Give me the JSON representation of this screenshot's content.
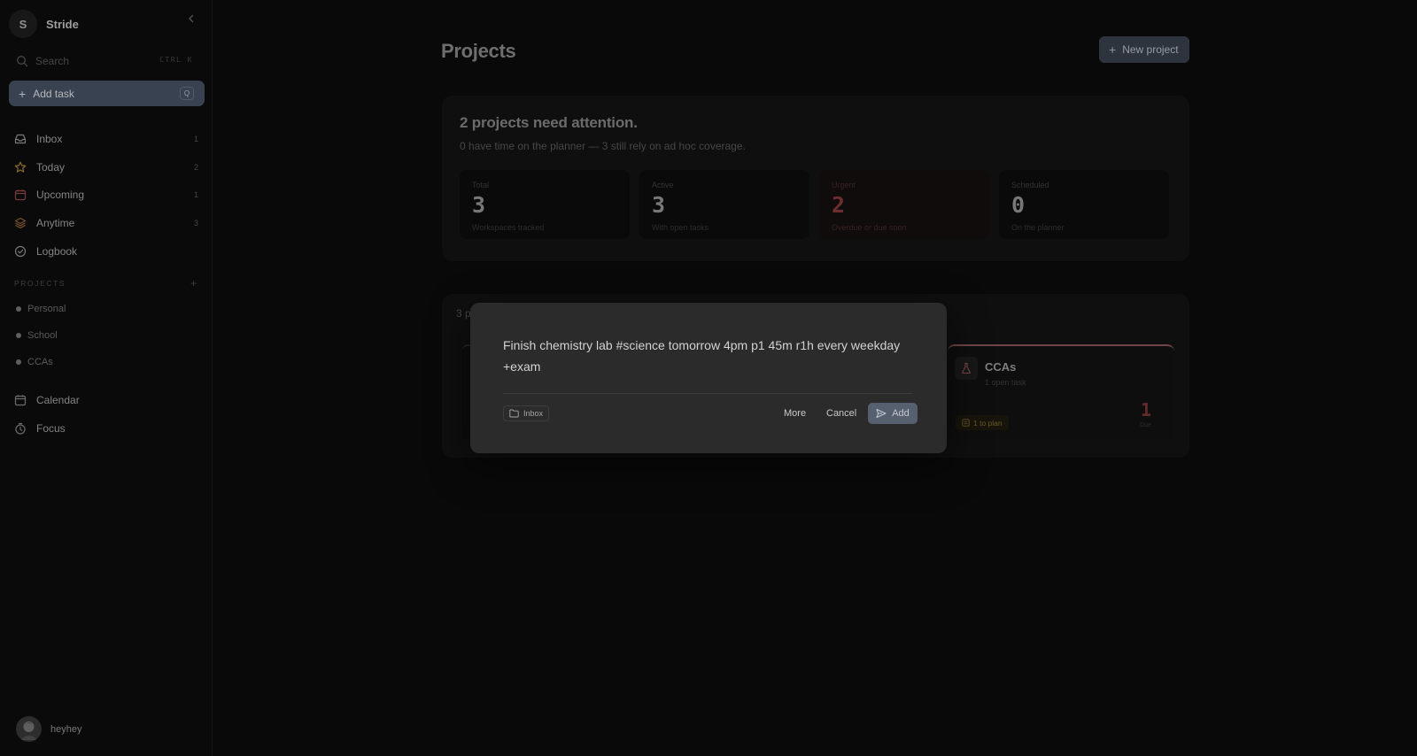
{
  "app": {
    "initial": "S",
    "name": "Stride"
  },
  "search": {
    "label": "Search",
    "shortcut": "CTRL K"
  },
  "add_task": {
    "label": "Add task",
    "shortcut": "Q"
  },
  "nav": [
    {
      "label": "Inbox",
      "count": "1",
      "icon": "inbox-icon"
    },
    {
      "label": "Today",
      "count": "2",
      "icon": "star-icon"
    },
    {
      "label": "Upcoming",
      "count": "1",
      "icon": "calendar-icon"
    },
    {
      "label": "Anytime",
      "count": "3",
      "icon": "layers-icon"
    },
    {
      "label": "Logbook",
      "count": "",
      "icon": "check-circle-icon"
    }
  ],
  "projects_section": {
    "header": "PROJECTS",
    "items": [
      "Personal",
      "School",
      "CCAs"
    ]
  },
  "bottom_nav": [
    {
      "label": "Calendar",
      "icon": "calendar-icon"
    },
    {
      "label": "Focus",
      "icon": "timer-icon"
    }
  ],
  "user": {
    "name": "heyhey"
  },
  "main": {
    "title": "Projects",
    "new_project_label": "New project",
    "summary": {
      "title": "2 projects need attention.",
      "subtitle": "0 have time on the planner — 3 still rely on ad hoc coverage.",
      "stats": [
        {
          "label": "Total",
          "value": "3",
          "caption": "Workspaces tracked"
        },
        {
          "label": "Active",
          "value": "3",
          "caption": "With open tasks"
        },
        {
          "label": "Urgent",
          "value": "2",
          "caption": "Overdue or due soon"
        },
        {
          "label": "Scheduled",
          "value": "0",
          "caption": "On the planner"
        }
      ]
    },
    "list": {
      "count_label": "3 p",
      "visible_card": {
        "name": "CCAs",
        "subtitle": "1 open task",
        "badge": "1 to plan",
        "number": "1",
        "number_caption": "Due"
      }
    }
  },
  "quick_add": {
    "input_text": "Finish chemistry lab #science tomorrow 4pm p1 45m r1h every weekday +exam",
    "project_chip": "Inbox",
    "more_label": "More",
    "cancel_label": "Cancel",
    "add_label": "Add"
  },
  "colors": {
    "accent": "#4a5568",
    "urgent": "#8a3a3a",
    "badge": "#8a7230",
    "modal_bg": "#2b2b2b"
  }
}
